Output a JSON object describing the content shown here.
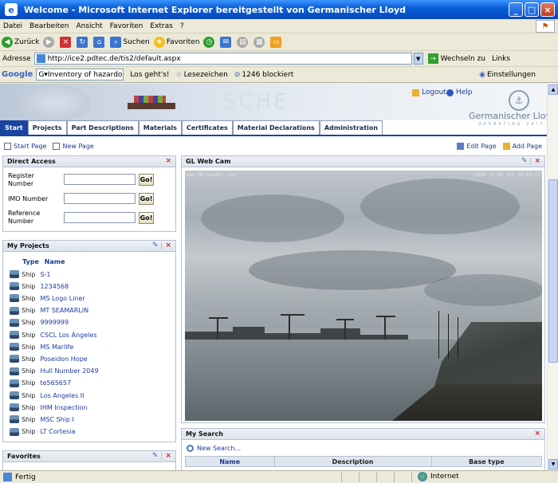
{
  "window": {
    "title": "Welcome - Microsoft Internet Explorer bereitgestellt von Germanischer Lloyd"
  },
  "menu": [
    "Datei",
    "Bearbeiten",
    "Ansicht",
    "Favoriten",
    "Extras",
    "?"
  ],
  "toolbar": {
    "back": "Zurück",
    "search": "Suchen",
    "favorites": "Favoriten"
  },
  "address": {
    "label": "Adresse",
    "url": "http://ice2.pdtec.de/tis2/default.aspx",
    "go": "Wechseln zu",
    "links": "Links"
  },
  "google": {
    "logo": "Google",
    "query": "G▾Inventory of hazardous",
    "goto": "Los geht's!",
    "bookmarks": "Lesezeichen",
    "blocked": "1246 blockiert",
    "settings": "Einstellungen"
  },
  "header": {
    "logout": "Logout",
    "help": "Help",
    "watermark": "SCHE",
    "brand": "Germanischer Lloyd",
    "tagline": "OPERATING 24/7"
  },
  "nav": {
    "tabs": [
      "Start",
      "Projects",
      "Part Descriptions",
      "Materials",
      "Certificates",
      "Material Declarations",
      "Administration"
    ],
    "active": "Start"
  },
  "pagelinks": {
    "start_page": "Start Page",
    "new_page": "New Page",
    "edit_page": "Edit Page",
    "add_page": "Add Page"
  },
  "direct_access": {
    "title": "Direct Access",
    "register_label": "Register\nNumber",
    "imo_label": "IMO Number",
    "reference_label": "Reference\nNumber",
    "go_label": "Go!"
  },
  "my_projects": {
    "title": "My Projects",
    "col_type": "Type",
    "col_name": "Name",
    "items": [
      {
        "type": "Ship",
        "name": "S-1"
      },
      {
        "type": "Ship",
        "name": "1234568"
      },
      {
        "type": "Ship",
        "name": "MS Logo Liner"
      },
      {
        "type": "Ship",
        "name": "MT SEAMARLIN"
      },
      {
        "type": "Ship",
        "name": "9999999"
      },
      {
        "type": "Ship",
        "name": "CSCL Los Angeles"
      },
      {
        "type": "Ship",
        "name": "MS Marlife"
      },
      {
        "type": "Ship",
        "name": "Poseidon Hope"
      },
      {
        "type": "Ship",
        "name": "Hull Number 2049"
      },
      {
        "type": "Ship",
        "name": "te565657"
      },
      {
        "type": "Ship",
        "name": "Los Angeles II"
      },
      {
        "type": "Ship",
        "name": "IHM Inspection"
      },
      {
        "type": "Ship",
        "name": "MSC Ship I"
      },
      {
        "type": "Ship",
        "name": "LT Cortesia"
      }
    ]
  },
  "favorites": {
    "title": "Favorites"
  },
  "webcam": {
    "title": "GL Web Cam",
    "stamp_left": "www.hh-wasser.com",
    "stamp_right": "2008-11-18 CET 09:29:21"
  },
  "my_search": {
    "title": "My Search",
    "new_search": "New Search...",
    "columns": [
      "Name",
      "Description",
      "Base type"
    ]
  },
  "status": {
    "text": "Fertig",
    "zone": "Internet"
  }
}
